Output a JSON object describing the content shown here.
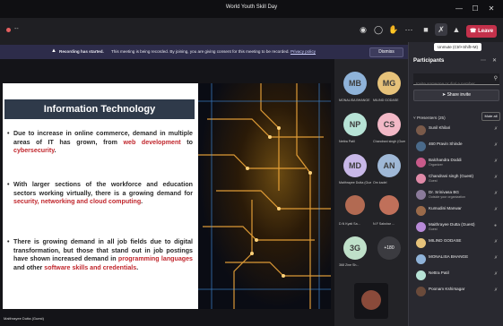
{
  "window": {
    "title": "World Youth Skill Day",
    "controls": [
      "—",
      "☐",
      "✕"
    ]
  },
  "toolbar": {
    "left_text": "--",
    "leave_label": "Leave",
    "tooltip": "Unmute (Ctrl+Shift+M)"
  },
  "banner": {
    "title": "Recording has started.",
    "text": "This meeting is being recorded. By joining, you are giving consent for this meeting to be recorded.",
    "link": "Privacy policy",
    "dismiss_label": "Dismiss"
  },
  "slide": {
    "title": "Information Technology",
    "bullets": [
      {
        "pre": "Due to increase in online commerce, demand in multiple areas of IT has grown, from ",
        "red1": "web development",
        "mid": " to ",
        "red2": "cybersecurity",
        "post": "."
      },
      {
        "pre": "With larger sections of the workforce and education sectors working virtually, there is a growing demand for ",
        "red1": "security, networking and cloud computing",
        "mid": "",
        "red2": "",
        "post": "."
      },
      {
        "pre": "There is growing demand in all job fields due to digital transformation, but those that stand out in job postings have shown increased demand in ",
        "red1": "programming languages",
        "mid": " and other ",
        "red2": "software skills and credentials",
        "post": "."
      }
    ],
    "presenter_label": "Maithrayee Dutta (Guest)"
  },
  "gallery": {
    "tiles": [
      {
        "initials": "MB",
        "label": "MONALISA BHANGE",
        "color": "#8fb3d9"
      },
      {
        "initials": "MG",
        "label": "MILIND GODASE",
        "color": "#e6c27a"
      },
      {
        "initials": "NP",
        "label": "Nettra Patil",
        "color": "#b7e3d6"
      },
      {
        "initials": "CS",
        "label": "Chandrani singh (Guest)",
        "color": "#f2b8c6"
      },
      {
        "initials": "MD",
        "label": "Maithrayee Dutta (Guest)",
        "color": "#c8b8e8"
      },
      {
        "initials": "AN",
        "label": "Om kadel",
        "color": "#9fb8d6"
      },
      {
        "initials": "",
        "label": "D.N Kyati Sa...",
        "color": "#b26a52"
      },
      {
        "initials": "",
        "label": "N.F Sakshar ...",
        "color": "#c0705a"
      },
      {
        "initials": "3G",
        "label": "368 Zine Sh...",
        "color": "#bfe0c9"
      },
      {
        "initials": "+180",
        "label": "",
        "color": "#3b3b40"
      }
    ]
  },
  "panel": {
    "title": "Participants",
    "invite_placeholder": "Invite someone or dial a number",
    "share_label": "Share invite",
    "section_label": "Presenters (25)",
    "mute_all_label": "Mute all",
    "participants": [
      {
        "name": "Sunil Khilari",
        "sub": ""
      },
      {
        "name": "460 Pravin Shinde",
        "sub": ""
      },
      {
        "name": "Balchandra Doddi",
        "sub": "Organizer"
      },
      {
        "name": "Chandrani singh (Guest)",
        "sub": "Guest"
      },
      {
        "name": "Dr. Srinivasa BG",
        "sub": "Outside your organization"
      },
      {
        "name": "Kumudini Manwar",
        "sub": ""
      },
      {
        "name": "Maithrayee Dutta (Guest)",
        "sub": "Guest"
      },
      {
        "name": "MILIND GODASE",
        "sub": ""
      },
      {
        "name": "MONALISA BHANGE",
        "sub": ""
      },
      {
        "name": "Nettra Patil",
        "sub": ""
      },
      {
        "name": "Poonam Kshirsagar",
        "sub": ""
      }
    ]
  }
}
